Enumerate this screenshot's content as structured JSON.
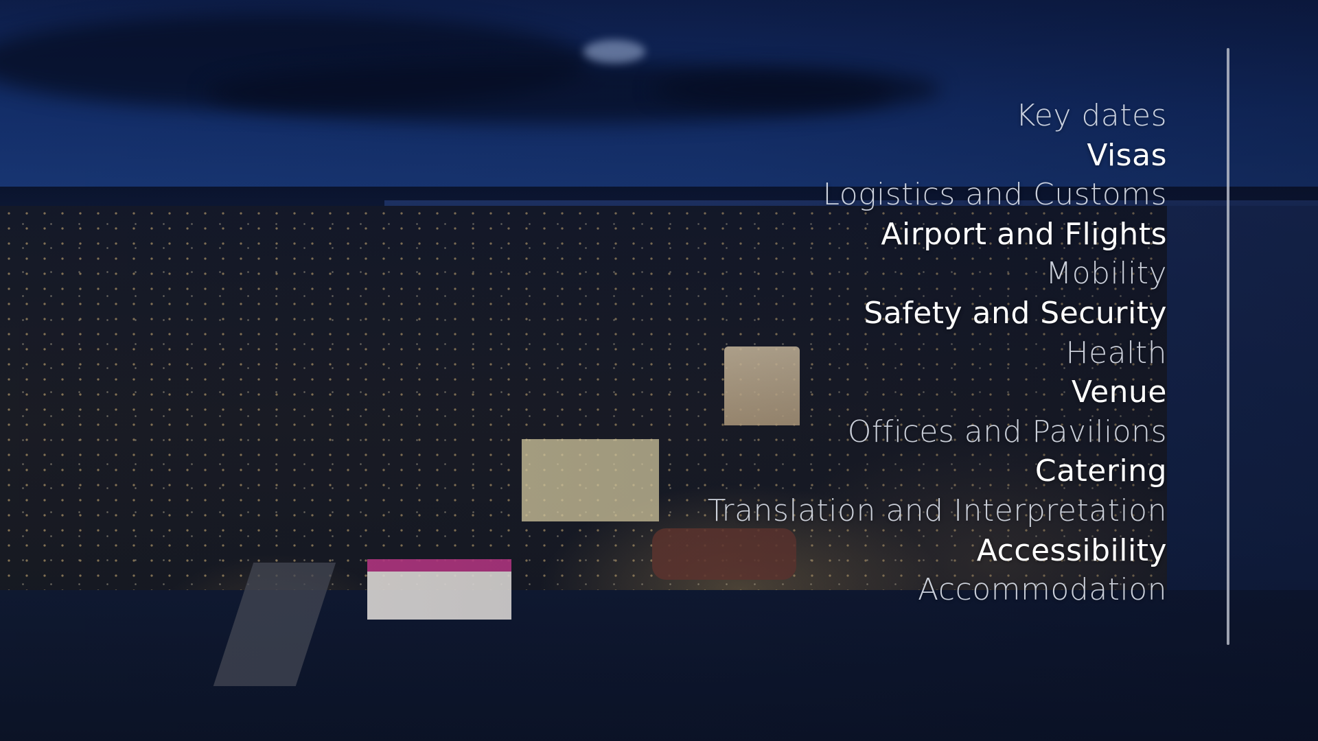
{
  "background": {
    "description_icon": "night-aerial-city-photo"
  },
  "menu": {
    "items": [
      {
        "label": "Key dates",
        "style": "light"
      },
      {
        "label": "Visas",
        "style": "bold"
      },
      {
        "label": "Logistics and Customs",
        "style": "light"
      },
      {
        "label": "Airport and Flights",
        "style": "bold"
      },
      {
        "label": "Mobility",
        "style": "light"
      },
      {
        "label": "Safety and Security",
        "style": "bold"
      },
      {
        "label": "Health",
        "style": "light"
      },
      {
        "label": "Venue",
        "style": "bold"
      },
      {
        "label": "Offices and Pavilions",
        "style": "light"
      },
      {
        "label": "Catering",
        "style": "bold"
      },
      {
        "label": "Translation and Interpretation",
        "style": "light"
      },
      {
        "label": "Accessibility",
        "style": "bold"
      },
      {
        "label": "Accommodation",
        "style": "light"
      }
    ]
  },
  "colors": {
    "text_light": "#dfe4ee",
    "text_bold": "#ffffff",
    "divider": "#b8bcc8",
    "sky": "#14306e"
  }
}
